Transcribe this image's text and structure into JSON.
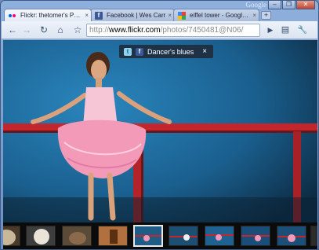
{
  "window": {
    "brand": "Google",
    "controls": {
      "minimize": "‒",
      "maximize": "❐",
      "close": "✕"
    }
  },
  "tabs": [
    {
      "title": "Flickr: thetomer's P…",
      "icon": "flickr-icon"
    },
    {
      "title": "Facebook | Wes Carr",
      "icon": "facebook-icon"
    },
    {
      "title": "eiffel tower - Googl…",
      "icon": "google-icon"
    }
  ],
  "new_tab": "+",
  "toolbar": {
    "back": "←",
    "forward": "→",
    "reload": "↻",
    "home": "⌂",
    "star": "☆",
    "go": "▶",
    "page_menu": "▤",
    "tools_menu": "🔧"
  },
  "omnibox": {
    "scheme": "http://",
    "host": "www.flickr.com",
    "path": "/photos/7450481@N06/"
  },
  "photo_caption": {
    "title": "Dancer's blues",
    "close": "×",
    "share_icons": [
      "twitter-icon",
      "facebook-icon"
    ]
  },
  "filmstrip": {
    "thumbnails": [
      {
        "name": "thumb-dog",
        "bg": "#4a3a2a"
      },
      {
        "name": "thumb-poodle",
        "bg": "#3d3d3d"
      },
      {
        "name": "thumb-dog-2",
        "bg": "#5a4a38"
      },
      {
        "name": "thumb-figure",
        "bg": "#b07040"
      },
      {
        "name": "thumb-dancer-selected",
        "bg": "#1f5c86"
      },
      {
        "name": "thumb-dancer-2",
        "bg": "#1d4f73"
      },
      {
        "name": "thumb-dancer-3",
        "bg": "#1f6292"
      },
      {
        "name": "thumb-dancer-4",
        "bg": "#1a4d77"
      },
      {
        "name": "thumb-dancer-5",
        "bg": "#1b4f78"
      }
    ],
    "selected_index": 4
  },
  "colors": {
    "wall": "#1b6fa3",
    "bar": "#c1272d",
    "tutu": "#f49ab9",
    "skin": "#d9a27c"
  }
}
